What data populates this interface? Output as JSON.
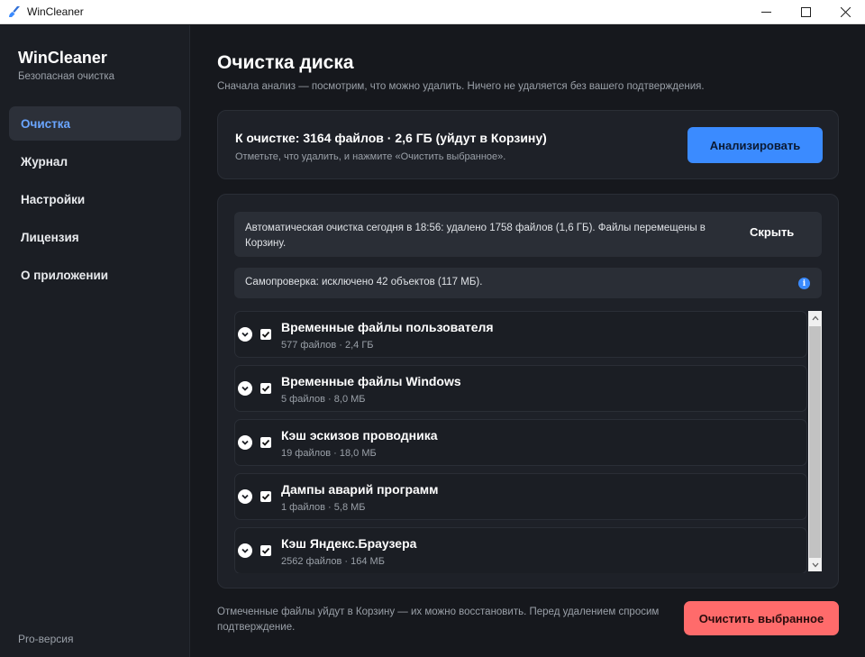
{
  "window": {
    "title": "WinCleaner",
    "minimize": "—",
    "maximize": "☐",
    "close": "✕"
  },
  "sidebar": {
    "brand": "WinCleaner",
    "tagline": "Безопасная очистка",
    "items": [
      {
        "label": "Очистка",
        "active": true
      },
      {
        "label": "Журнал"
      },
      {
        "label": "Настройки"
      },
      {
        "label": "Лицензия"
      },
      {
        "label": "О приложении"
      }
    ],
    "edition": "Pro-версия"
  },
  "main": {
    "title": "Очистка диска",
    "subtitle": "Сначала анализ — посмотрим, что можно удалить. Ничего не удаляется без вашего подтверждения.",
    "summary": {
      "title": "К очистке: 3164 файлов · 2,6 ГБ (уйдут в Корзину)",
      "hint": "Отметьте, что удалить, и нажмите «Очистить выбранное».",
      "analyze_label": "Анализировать"
    },
    "notice": {
      "text": "Автоматическая очистка сегодня в 18:56: удалено 1758 файлов (1,6 ГБ). Файлы перемещены в Корзину.",
      "hide_label": "Скрыть"
    },
    "selfcheck": {
      "text": "Самопроверка: исключено 42 объектов (117 МБ).",
      "info_glyph": "i"
    },
    "categories": [
      {
        "name": "Временные файлы пользователя",
        "meta": "577 файлов · 2,4 ГБ",
        "checked": true
      },
      {
        "name": "Временные файлы Windows",
        "meta": "5 файлов · 8,0 МБ",
        "checked": true
      },
      {
        "name": "Кэш эскизов проводника",
        "meta": "19 файлов · 18,0 МБ",
        "checked": true
      },
      {
        "name": "Дампы аварий программ",
        "meta": "1 файлов · 5,8 МБ",
        "checked": true
      },
      {
        "name": "Кэш Яндекс.Браузера",
        "meta": "2562 файлов · 164 МБ",
        "checked": true
      }
    ],
    "footer_note": "Отмеченные файлы уйдут в Корзину — их можно восстановить. Перед удалением спросим подтверждение.",
    "clean_label": "Очистить выбранное"
  },
  "colors": {
    "accent": "#3b8bff",
    "danger": "#ff6b6b",
    "background": "#16181d",
    "sidebar": "#1b1e24"
  }
}
